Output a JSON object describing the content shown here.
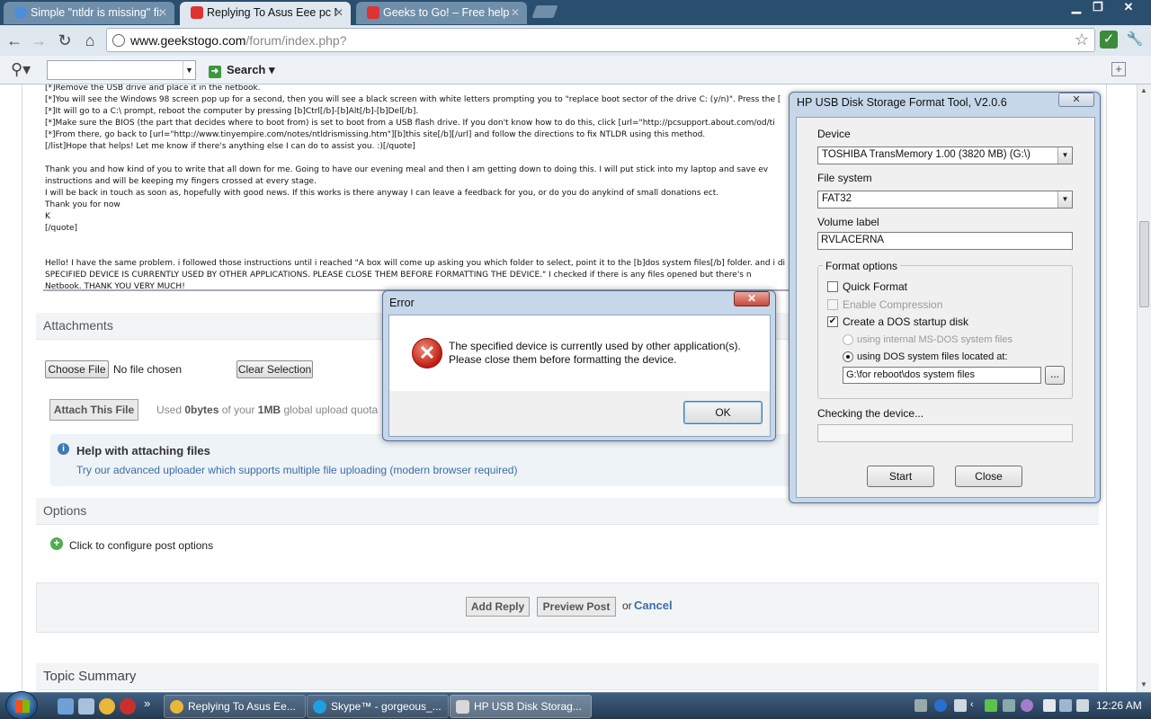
{
  "browser": {
    "tabs": [
      {
        "title": "Simple \"ntldr is missing\" fix",
        "active": false,
        "favicon": "globe-icon"
      },
      {
        "title": "Replying To Asus Eee pc Ne",
        "active": true,
        "favicon": "geekstogo-icon"
      },
      {
        "title": "Geeks to Go! – Free help fro",
        "active": false,
        "favicon": "geekstogo-icon"
      }
    ],
    "url_host": "www.geekstogo.com",
    "url_path": "/forum/index.php?",
    "search_button": "Search"
  },
  "editor_lines": [
    "[*]Remove the USB drive and place it in the netbook.",
    "[*]You will see the Windows 98 screen pop up for a second, then you will see a black screen with white letters prompting you to \"replace boot sector of the drive C: (y/n)\". Press the [",
    "[*]It will go to a C:\\ prompt, reboot the computer by pressing [b]Ctrl[/b]-[b]Alt[/b]-[b]Del[/b].",
    "[*]Make sure the BIOS (the part that decides where to boot from) is set to boot from a USB flash drive. If you don't know how to do this, click [url=\"http://pcsupport.about.com/od/ti",
    "[*]From there, go back to [url=\"http://www.tinyempire.com/notes/ntldrismissing.htm\"][b]this site[/b][/url] and follow the directions to fix NTLDR using this method.",
    "[/list]Hope that helps! Let me know if there's anything else I can do to assist you. :)[/quote]",
    "",
    "Thank you and how kind of you to write that all down for me. Going to have our evening meal and then I am getting down to doing this. I will put stick into my laptop and save ev",
    "instructions and will be keeping my fingers crossed at every stage.",
    "I will be back in touch as soon as, hopefully with good news. If this works is there anyway I can leave a feedback for you, or do you do anykind of small donations ect.",
    "Thank you for now",
    "K",
    "[/quote]",
    "",
    "",
    "Hello! I have the same problem. i followed those instructions until i reached \"A box will come up asking you which folder to select, point it to the [b]dos system files[/b] folder. and i di",
    "SPECIFIED DEVICE IS CURRENTLY USED BY OTHER APPLICATIONS. PLEASE CLOSE THEM BEFORE FORMATTING THE DEVICE.\" I checked if there is any files opened but there's n",
    "Netbook. THANK YOU VERY MUCH!"
  ],
  "attachments": {
    "heading": "Attachments",
    "choose_file": "Choose File",
    "no_file": "No file chosen",
    "clear_selection": "Clear Selection",
    "attach_button": "Attach This File",
    "quota_used_prefix": "Used",
    "quota_used_value": "0bytes",
    "quota_mid": "of your",
    "quota_total": "1MB",
    "quota_suffix": "global upload quota",
    "help_title": "Help with attaching files",
    "help_link": "Try our advanced uploader which supports multiple file uploading (modern browser required)"
  },
  "options": {
    "heading": "Options",
    "configure": "Click to configure post options"
  },
  "reply": {
    "add_reply": "Add Reply",
    "preview": "Preview Post",
    "or": "or",
    "cancel": "Cancel"
  },
  "topic_summary": "Topic Summary",
  "hp_tool": {
    "title": "HP USB Disk Storage Format Tool, V2.0.6",
    "close_x": "✕",
    "device_label": "Device",
    "device_value": "TOSHIBA TransMemory 1.00 (3820 MB) (G:\\)",
    "fs_label": "File system",
    "fs_value": "FAT32",
    "volume_label": "Volume label",
    "volume_value": "RVLACERNA",
    "format_options": "Format options",
    "quick_format": "Quick Format",
    "enable_compression": "Enable Compression",
    "create_dos": "Create a DOS startup disk",
    "internal_msdos": "using internal MS-DOS system files",
    "using_dos_files": "using DOS system files located at:",
    "dos_path": "G:\\for reboot\\dos system files",
    "browse": "...",
    "status": "Checking the device...",
    "start": "Start",
    "close": "Close",
    "progress": 0
  },
  "error_dialog": {
    "title": "Error",
    "line1": "The specified device is currently used by other application(s).",
    "line2": "Please close them before formatting the device.",
    "ok": "OK",
    "close_x": "✕"
  },
  "taskbar": {
    "tasks": [
      {
        "label": "Replying To Asus Ee...",
        "icon": "chrome-icon",
        "active": false
      },
      {
        "label": "Skype™ - gorgeous_...",
        "icon": "skype-icon",
        "active": false
      },
      {
        "label": "HP USB Disk Storag...",
        "icon": "hp-tool-icon",
        "active": true
      }
    ],
    "clock": "12:26 AM",
    "more": "»"
  },
  "colors": {
    "link": "#3a6ea5",
    "error_red": "#c21c10",
    "window_frame": "#c6d7ea"
  }
}
